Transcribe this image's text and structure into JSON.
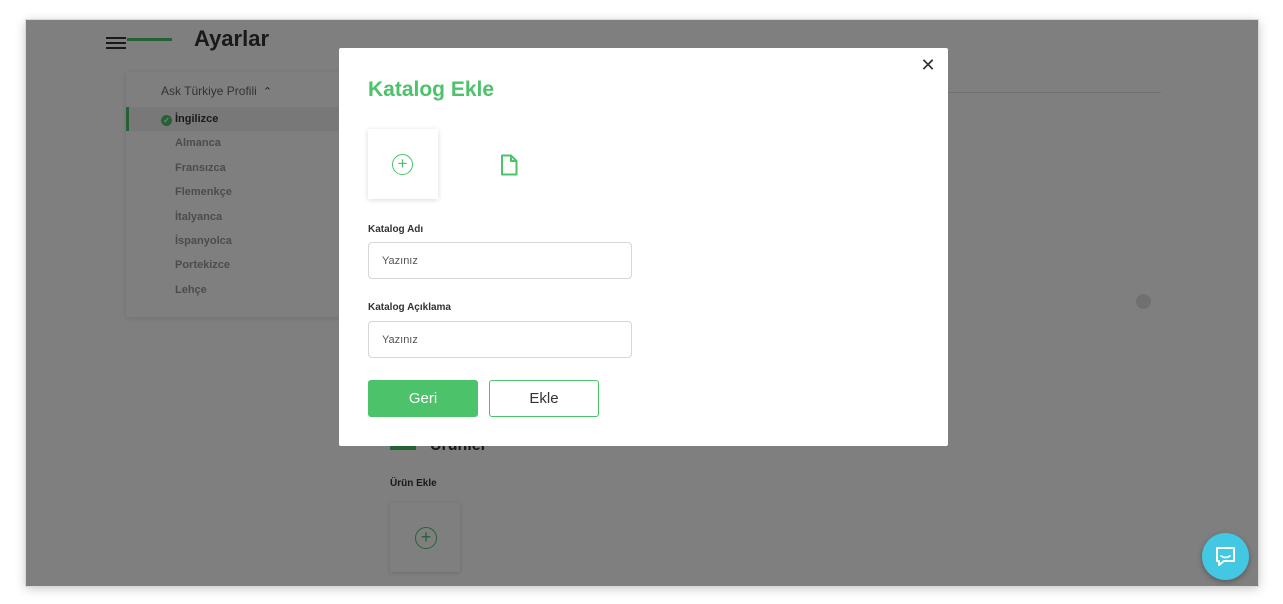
{
  "app": {
    "page_title": "Ayarlar",
    "profile_header": "Ask Türkiye Profili",
    "languages": [
      {
        "label": "İngilizce",
        "active": true
      },
      {
        "label": "Almanca",
        "active": false
      },
      {
        "label": "Fransızca",
        "active": false
      },
      {
        "label": "Flemenkçe",
        "active": false
      },
      {
        "label": "İtalyanca",
        "active": false
      },
      {
        "label": "İspanyolca",
        "active": false
      },
      {
        "label": "Portekizce",
        "active": false
      },
      {
        "label": "Lehçe",
        "active": false
      }
    ],
    "products_section_title": "Ürünler",
    "add_product_label": "Ürün Ekle"
  },
  "modal": {
    "title": "Katalog Ekle",
    "catalog_name_label": "Katalog Adı",
    "catalog_name_placeholder": "Yazınız",
    "catalog_desc_label": "Katalog Açıklama",
    "catalog_desc_placeholder": "Yazınız",
    "back_label": "Geri",
    "add_label": "Ekle"
  },
  "icons": {
    "menu": "hamburger-menu-icon",
    "close": "close-icon",
    "upload": "plus-circle-icon",
    "file": "file-icon",
    "chat": "chat-icon",
    "check": "check-circle-icon"
  },
  "colors": {
    "accent": "#4cc26a",
    "overlay": "rgba(0,0,0,0.5)",
    "chat": "#42c8e2"
  }
}
